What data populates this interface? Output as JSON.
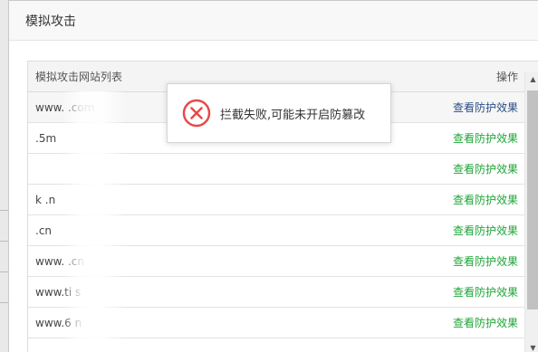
{
  "dialog": {
    "title": "模拟攻击"
  },
  "table": {
    "header_site": "模拟攻击网站列表",
    "header_action": "操作",
    "rows": [
      {
        "site": "www.       .com",
        "action": "查看防护效果"
      },
      {
        "site": "           .5m",
        "action": "查看防护效果"
      },
      {
        "site": "              ",
        "action": "查看防护效果"
      },
      {
        "site": "k   .n",
        "action": "查看防护效果"
      },
      {
        "site": "           .cn",
        "action": "查看防护效果"
      },
      {
        "site": "www.       .cn",
        "action": "查看防护效果"
      },
      {
        "site": "www.ti      s",
        "action": "查看防护效果"
      },
      {
        "site": "www.6       n",
        "action": "查看防护效果"
      }
    ]
  },
  "toast": {
    "message": "拦截失败,可能未开启防篡改",
    "icon": "error-circle-icon",
    "color": "#e64a4a"
  },
  "colors": {
    "action_green": "#20a53a",
    "action_first": "#2a4f86"
  }
}
